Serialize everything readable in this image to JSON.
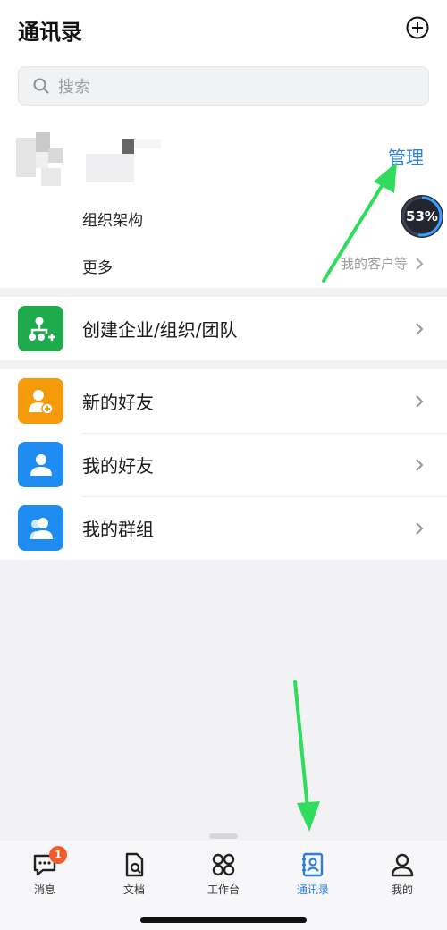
{
  "header": {
    "title": "通讯录"
  },
  "search": {
    "placeholder": "搜索"
  },
  "org": {
    "manage_label": "管理",
    "structure_label": "组织架构",
    "more_label": "更多",
    "more_right": "我的客户等",
    "progress_badge": "53%"
  },
  "create_org": {
    "label": "创建企业/组织/团队",
    "color": "#1fab4b"
  },
  "contacts": [
    {
      "label": "新的好友",
      "color": "#f59a0b"
    },
    {
      "label": "我的好友",
      "color": "#1e8cf0"
    },
    {
      "label": "我的群组",
      "color": "#1e8cf0"
    }
  ],
  "tabbar": {
    "items": [
      {
        "label": "消息",
        "badge": "1"
      },
      {
        "label": "文档"
      },
      {
        "label": "工作台"
      },
      {
        "label": "通讯录",
        "active": true
      },
      {
        "label": "我的"
      }
    ]
  },
  "colors": {
    "accent": "#2e7fd9",
    "annotation_arrow": "#2fdc5c"
  }
}
